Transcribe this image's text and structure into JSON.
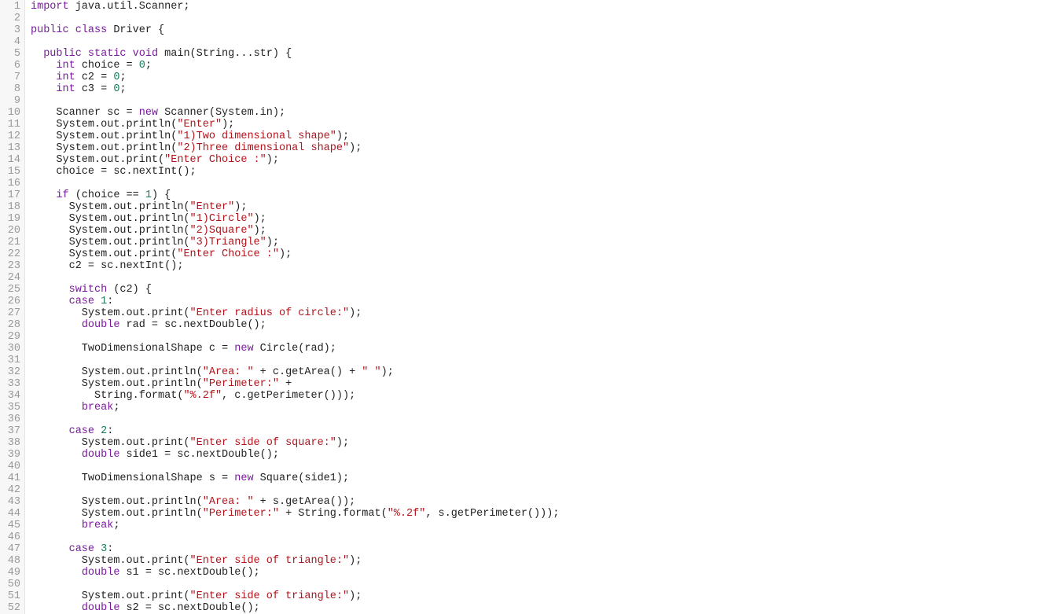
{
  "editor": {
    "language": "java",
    "colors": {
      "keyword": "#7a1a9e",
      "string": "#b2141c",
      "number": "#177a5e",
      "text": "#222222",
      "line_number": "#999999",
      "gutter_bg": "#f7f7f7"
    },
    "lines": [
      [
        [
          "kw",
          "import"
        ],
        [
          "t",
          " java.util.Scanner;"
        ]
      ],
      [],
      [
        [
          "kw",
          "public"
        ],
        [
          "t",
          " "
        ],
        [
          "kw",
          "class"
        ],
        [
          "t",
          " Driver {"
        ]
      ],
      [],
      [
        [
          "t",
          "  "
        ],
        [
          "kw",
          "public"
        ],
        [
          "t",
          " "
        ],
        [
          "kw",
          "static"
        ],
        [
          "t",
          " "
        ],
        [
          "kw",
          "void"
        ],
        [
          "t",
          " main(String...str) {"
        ]
      ],
      [
        [
          "t",
          "    "
        ],
        [
          "kw",
          "int"
        ],
        [
          "t",
          " choice = "
        ],
        [
          "nu",
          "0"
        ],
        [
          "t",
          ";"
        ]
      ],
      [
        [
          "t",
          "    "
        ],
        [
          "kw",
          "int"
        ],
        [
          "t",
          " c2 = "
        ],
        [
          "nu",
          "0"
        ],
        [
          "t",
          ";"
        ]
      ],
      [
        [
          "t",
          "    "
        ],
        [
          "kw",
          "int"
        ],
        [
          "t",
          " c3 = "
        ],
        [
          "nu",
          "0"
        ],
        [
          "t",
          ";"
        ]
      ],
      [],
      [
        [
          "t",
          "    Scanner sc = "
        ],
        [
          "kw",
          "new"
        ],
        [
          "t",
          " Scanner(System.in);"
        ]
      ],
      [
        [
          "t",
          "    System.out.println("
        ],
        [
          "st",
          "\"Enter\""
        ],
        [
          "t",
          ");"
        ]
      ],
      [
        [
          "t",
          "    System.out.println("
        ],
        [
          "st",
          "\"1)Two dimensional shape\""
        ],
        [
          "t",
          ");"
        ]
      ],
      [
        [
          "t",
          "    System.out.println("
        ],
        [
          "st",
          "\"2)Three dimensional shape\""
        ],
        [
          "t",
          ");"
        ]
      ],
      [
        [
          "t",
          "    System.out.print("
        ],
        [
          "st",
          "\"Enter Choice :\""
        ],
        [
          "t",
          ");"
        ]
      ],
      [
        [
          "t",
          "    choice = sc.nextInt();"
        ]
      ],
      [],
      [
        [
          "t",
          "    "
        ],
        [
          "kw",
          "if"
        ],
        [
          "t",
          " (choice == "
        ],
        [
          "nu",
          "1"
        ],
        [
          "t",
          ") {"
        ]
      ],
      [
        [
          "t",
          "      System.out.println("
        ],
        [
          "st",
          "\"Enter\""
        ],
        [
          "t",
          ");"
        ]
      ],
      [
        [
          "t",
          "      System.out.println("
        ],
        [
          "st",
          "\"1)Circle\""
        ],
        [
          "t",
          ");"
        ]
      ],
      [
        [
          "t",
          "      System.out.println("
        ],
        [
          "st",
          "\"2)Square\""
        ],
        [
          "t",
          ");"
        ]
      ],
      [
        [
          "t",
          "      System.out.println("
        ],
        [
          "st",
          "\"3)Triangle\""
        ],
        [
          "t",
          ");"
        ]
      ],
      [
        [
          "t",
          "      System.out.print("
        ],
        [
          "st",
          "\"Enter Choice :\""
        ],
        [
          "t",
          ");"
        ]
      ],
      [
        [
          "t",
          "      c2 = sc.nextInt();"
        ]
      ],
      [],
      [
        [
          "t",
          "      "
        ],
        [
          "kw",
          "switch"
        ],
        [
          "t",
          " (c2) {"
        ]
      ],
      [
        [
          "t",
          "      "
        ],
        [
          "kw",
          "case"
        ],
        [
          "t",
          " "
        ],
        [
          "nu",
          "1"
        ],
        [
          "t",
          ":"
        ]
      ],
      [
        [
          "t",
          "        System.out.print("
        ],
        [
          "st",
          "\"Enter radius of circle:\""
        ],
        [
          "t",
          ");"
        ]
      ],
      [
        [
          "t",
          "        "
        ],
        [
          "kw",
          "double"
        ],
        [
          "t",
          " rad = sc.nextDouble();"
        ]
      ],
      [],
      [
        [
          "t",
          "        TwoDimensionalShape c = "
        ],
        [
          "kw",
          "new"
        ],
        [
          "t",
          " Circle(rad);"
        ]
      ],
      [],
      [
        [
          "t",
          "        System.out.println("
        ],
        [
          "st",
          "\"Area: \""
        ],
        [
          "t",
          " + c.getArea() + "
        ],
        [
          "st",
          "\" \""
        ],
        [
          "t",
          ");"
        ]
      ],
      [
        [
          "t",
          "        System.out.println("
        ],
        [
          "st",
          "\"Perimeter:\""
        ],
        [
          "t",
          " +"
        ]
      ],
      [
        [
          "t",
          "          String.format("
        ],
        [
          "st",
          "\"%.2f\""
        ],
        [
          "t",
          ", c.getPerimeter()));"
        ]
      ],
      [
        [
          "t",
          "        "
        ],
        [
          "kw",
          "break"
        ],
        [
          "t",
          ";"
        ]
      ],
      [],
      [
        [
          "t",
          "      "
        ],
        [
          "kw",
          "case"
        ],
        [
          "t",
          " "
        ],
        [
          "nu",
          "2"
        ],
        [
          "t",
          ":"
        ]
      ],
      [
        [
          "t",
          "        System.out.print("
        ],
        [
          "st",
          "\"Enter side of square:\""
        ],
        [
          "t",
          ");"
        ]
      ],
      [
        [
          "t",
          "        "
        ],
        [
          "kw",
          "double"
        ],
        [
          "t",
          " side1 = sc.nextDouble();"
        ]
      ],
      [],
      [
        [
          "t",
          "        TwoDimensionalShape s = "
        ],
        [
          "kw",
          "new"
        ],
        [
          "t",
          " Square(side1);"
        ]
      ],
      [],
      [
        [
          "t",
          "        System.out.println("
        ],
        [
          "st",
          "\"Area: \""
        ],
        [
          "t",
          " + s.getArea());"
        ]
      ],
      [
        [
          "t",
          "        System.out.println("
        ],
        [
          "st",
          "\"Perimeter:\""
        ],
        [
          "t",
          " + String.format("
        ],
        [
          "st",
          "\"%.2f\""
        ],
        [
          "t",
          ", s.getPerimeter()));"
        ]
      ],
      [
        [
          "t",
          "        "
        ],
        [
          "kw",
          "break"
        ],
        [
          "t",
          ";"
        ]
      ],
      [],
      [
        [
          "t",
          "      "
        ],
        [
          "kw",
          "case"
        ],
        [
          "t",
          " "
        ],
        [
          "nu",
          "3"
        ],
        [
          "t",
          ":"
        ]
      ],
      [
        [
          "t",
          "        System.out.print("
        ],
        [
          "st",
          "\"Enter side of triangle:\""
        ],
        [
          "t",
          ");"
        ]
      ],
      [
        [
          "t",
          "        "
        ],
        [
          "kw",
          "double"
        ],
        [
          "t",
          " s1 = sc.nextDouble();"
        ]
      ],
      [],
      [
        [
          "t",
          "        System.out.print("
        ],
        [
          "st",
          "\"Enter side of triangle:\""
        ],
        [
          "t",
          ");"
        ]
      ],
      [
        [
          "t",
          "        "
        ],
        [
          "kw",
          "double"
        ],
        [
          "t",
          " s2 = sc.nextDouble();"
        ]
      ]
    ]
  }
}
